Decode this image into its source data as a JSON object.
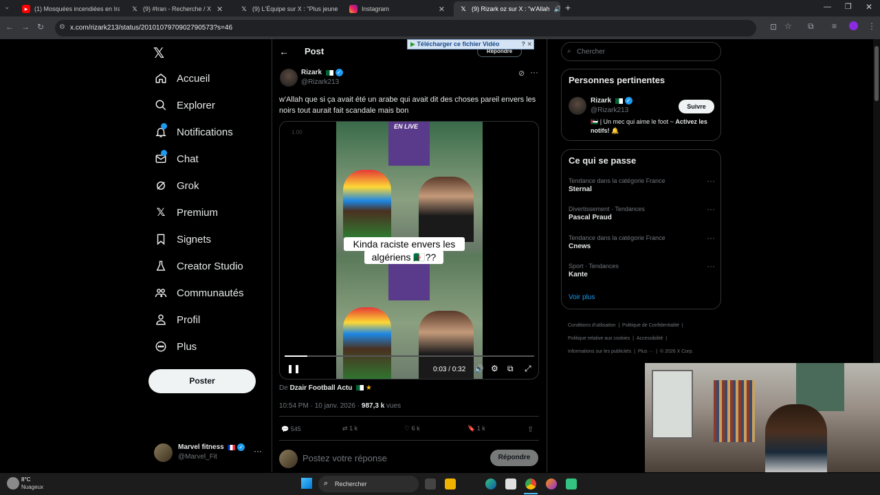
{
  "browser": {
    "tabs": [
      {
        "title": "(1) Mosquées incendiées en Ira",
        "icon": "youtube-icon"
      },
      {
        "title": "(9) #Iran - Recherche / X",
        "icon": "x-icon"
      },
      {
        "title": "(9) L'Équipe sur X : \"Plus jeune",
        "icon": "x-icon"
      },
      {
        "title": "Instagram",
        "icon": "instagram-icon"
      },
      {
        "title": "(9) Rizark oz sur X : \"w'Allah",
        "icon": "x-icon"
      }
    ],
    "url": "x.com/rizark213/status/2010107970902790573?s=46"
  },
  "nav": {
    "items": [
      {
        "label": "Accueil",
        "icon": "home-icon"
      },
      {
        "label": "Explorer",
        "icon": "search-icon"
      },
      {
        "label": "Notifications",
        "icon": "bell-icon"
      },
      {
        "label": "Chat",
        "icon": "mail-icon"
      },
      {
        "label": "Grok",
        "icon": "grok-icon"
      },
      {
        "label": "Premium",
        "icon": "x-logo-icon"
      },
      {
        "label": "Signets",
        "icon": "bookmark-icon"
      },
      {
        "label": "Creator Studio",
        "icon": "flask-icon"
      },
      {
        "label": "Communautés",
        "icon": "people-icon"
      },
      {
        "label": "Profil",
        "icon": "person-icon"
      },
      {
        "label": "Plus",
        "icon": "more-circle-icon"
      }
    ],
    "post_button": "Poster",
    "account": {
      "name": "Marvel fitness",
      "handle": "@Marvel_Fit"
    }
  },
  "post": {
    "header_title": "Post",
    "reply_top": "Répondre",
    "download_bar": "Télécharger ce fichier Vidéo",
    "author_name": "Rizark",
    "author_handle": "@Rizark213",
    "text": "w'Allah que si ça avait été un arabe qui avait dit des choses pareil envers les noirs tout aurait fait scandale mais bon",
    "video": {
      "speed": "1.00",
      "banner_live": "EN LIVE",
      "caption_line1": "Kinda raciste envers les",
      "caption_line2": "algériens 🇩🇿??",
      "time": "0:03 / 0:32",
      "progress": 0.09
    },
    "source_prefix": "De",
    "source_name": "Dzair Football Actu",
    "timestamp": "10:54 PM · 10 janv. 2026 ·",
    "views_count": "987,3 k",
    "views_label": "vues",
    "stats": {
      "replies": "545",
      "reposts": "1 k",
      "likes": "6 k",
      "bookmarks": "1 k"
    },
    "reply_placeholder": "Postez votre réponse",
    "reply_button": "Répondre"
  },
  "sidebar": {
    "search_placeholder": "Chercher",
    "relevant": {
      "title": "Personnes pertinentes",
      "name": "Rizark",
      "handle": "@Rizark213",
      "follow": "Suivre",
      "bio_plain": "🇵🇸 | Un mec qui aime le foot ~",
      "bio_bold": "Activez les notifs!",
      "bio_emoji": "🔔"
    },
    "trends": {
      "title": "Ce qui se passe",
      "items": [
        {
          "meta": "Tendance dans la catégorie France",
          "name": "Sternal"
        },
        {
          "meta": "Divertissement · Tendances",
          "name": "Pascal Praud"
        },
        {
          "meta": "Tendance dans la catégorie France",
          "name": "Cnews"
        },
        {
          "meta": "Sport · Tendances",
          "name": "Kante"
        }
      ],
      "more": "Voir plus"
    },
    "footer": {
      "l1": "Conditions d'utilisation",
      "l2": "Politique de Confidentialité",
      "l3": "Politique relative aux cookies",
      "l4": "Accessibilité",
      "l5": "Informations sur les publicités",
      "l6": "Plus ···",
      "l7": "© 2026 X Corp."
    }
  },
  "taskbar": {
    "weather_temp": "8°C",
    "weather_desc": "Nuageux",
    "search": "Rechercher"
  },
  "colors": {
    "accent": "#1d9bf0",
    "bg": "#000000",
    "border": "#2f3336"
  }
}
